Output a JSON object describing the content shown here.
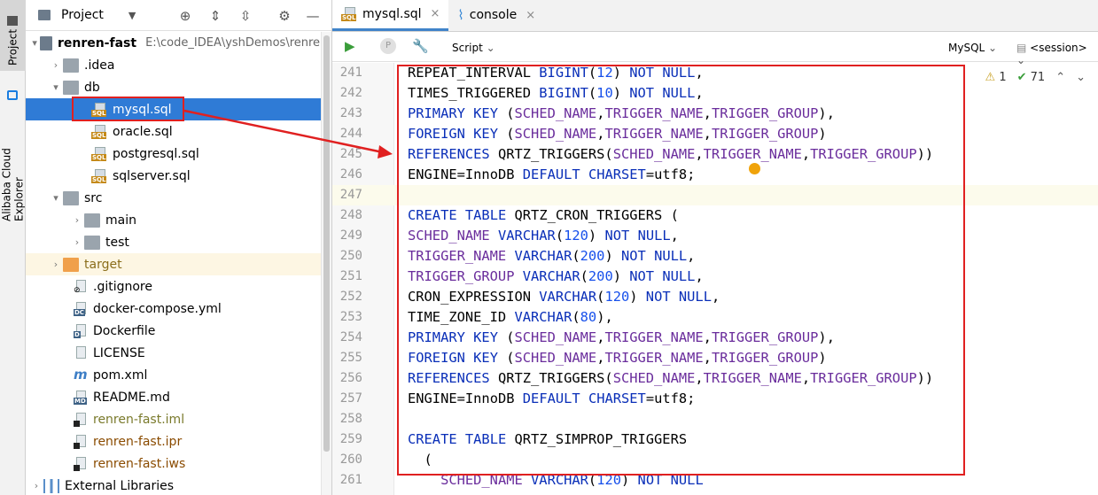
{
  "sidebar": {
    "tab_project": "Project",
    "tab_alibaba": "Alibaba Cloud Explorer"
  },
  "project_panel": {
    "title": "Project",
    "root": {
      "name": "renren-fast",
      "path": "E:\\code_IDEA\\yshDemos\\renren-"
    },
    "items": [
      {
        "label": ".idea"
      },
      {
        "label": "db"
      },
      {
        "label": "mysql.sql"
      },
      {
        "label": "oracle.sql"
      },
      {
        "label": "postgresql.sql"
      },
      {
        "label": "sqlserver.sql"
      },
      {
        "label": "src"
      },
      {
        "label": "main"
      },
      {
        "label": "test"
      },
      {
        "label": "target"
      },
      {
        "label": ".gitignore"
      },
      {
        "label": "docker-compose.yml"
      },
      {
        "label": "Dockerfile"
      },
      {
        "label": "LICENSE"
      },
      {
        "label": "pom.xml"
      },
      {
        "label": "README.md"
      },
      {
        "label": "renren-fast.iml"
      },
      {
        "label": "renren-fast.ipr"
      },
      {
        "label": "renren-fast.iws"
      },
      {
        "label": "External Libraries"
      }
    ],
    "badges": {
      "sql": "SQL",
      "dc": "DC",
      "d": "D",
      "md": "MD"
    }
  },
  "editor": {
    "tabs": [
      {
        "label": "mysql.sql",
        "close": "×"
      },
      {
        "label": "console",
        "close": "×"
      }
    ],
    "toolbar": {
      "script_label": "Script",
      "dialect": "MySQL",
      "session": "<session>",
      "p_label": "P"
    },
    "inspections": {
      "warnings": "1",
      "ok": "71"
    },
    "line_numbers": [
      "241",
      "242",
      "243",
      "244",
      "245",
      "246",
      "247",
      "248",
      "249",
      "250",
      "251",
      "252",
      "253",
      "254",
      "255",
      "256",
      "257",
      "258",
      "259",
      "260",
      "261"
    ],
    "code_lines": [
      "REPEAT_INTERVAL BIGINT(12) NOT NULL,",
      "TIMES_TRIGGERED BIGINT(10) NOT NULL,",
      "PRIMARY KEY (SCHED_NAME,TRIGGER_NAME,TRIGGER_GROUP),",
      "FOREIGN KEY (SCHED_NAME,TRIGGER_NAME,TRIGGER_GROUP)",
      "REFERENCES QRTZ_TRIGGERS(SCHED_NAME,TRIGGER_NAME,TRIGGER_GROUP))",
      "ENGINE=InnoDB DEFAULT CHARSET=utf8;",
      "",
      "CREATE TABLE QRTZ_CRON_TRIGGERS (",
      "SCHED_NAME VARCHAR(120) NOT NULL,",
      "TRIGGER_NAME VARCHAR(200) NOT NULL,",
      "TRIGGER_GROUP VARCHAR(200) NOT NULL,",
      "CRON_EXPRESSION VARCHAR(120) NOT NULL,",
      "TIME_ZONE_ID VARCHAR(80),",
      "PRIMARY KEY (SCHED_NAME,TRIGGER_NAME,TRIGGER_GROUP),",
      "FOREIGN KEY (SCHED_NAME,TRIGGER_NAME,TRIGGER_GROUP)",
      "REFERENCES QRTZ_TRIGGERS(SCHED_NAME,TRIGGER_NAME,TRIGGER_GROUP))",
      "ENGINE=InnoDB DEFAULT CHARSET=utf8;",
      "",
      "CREATE TABLE QRTZ_SIMPROP_TRIGGERS",
      "  (",
      "    SCHED_NAME VARCHAR(120) NOT NULL"
    ]
  },
  "colors": {
    "selection": "#2f7bd6",
    "annotation": "#e02020",
    "keyword": "#0a2fb8",
    "identifier": "#6a2d9c",
    "number": "#1750eb"
  }
}
